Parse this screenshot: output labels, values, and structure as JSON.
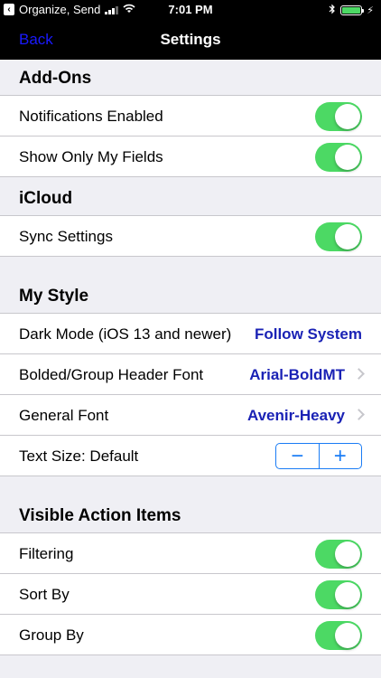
{
  "status": {
    "back_app": "Organize, Send",
    "time": "7:01 PM",
    "battery_color": "#4cd964"
  },
  "nav": {
    "back_label": "Back",
    "title": "Settings"
  },
  "sections": [
    {
      "header": "Add-Ons",
      "rows": [
        {
          "label": "Notifications Enabled",
          "toggle": true
        },
        {
          "label": "Show Only My Fields",
          "toggle": true
        }
      ]
    },
    {
      "header": "iCloud",
      "rows": [
        {
          "label": "Sync Settings",
          "toggle": true
        }
      ]
    },
    {
      "header": "My Style",
      "rows": [
        {
          "label": "Dark Mode (iOS 13 and newer)",
          "value": "Follow System"
        },
        {
          "label": "Bolded/Group Header Font",
          "value": "Arial-BoldMT"
        },
        {
          "label": "General Font",
          "value": "Avenir-Heavy"
        },
        {
          "label": "Text Size: Default",
          "stepper_minus": "−",
          "stepper_plus": "+"
        }
      ]
    },
    {
      "header": "Visible Action Items",
      "rows": [
        {
          "label": "Filtering",
          "toggle": true
        },
        {
          "label": "Sort By",
          "toggle": true
        },
        {
          "label": "Group By",
          "toggle": true
        }
      ]
    }
  ],
  "colors": {
    "toggle_on": "#4cd964",
    "value_text": "#1a22b5",
    "back_link": "#1a1aff",
    "stepper": "#1a7cf5"
  }
}
